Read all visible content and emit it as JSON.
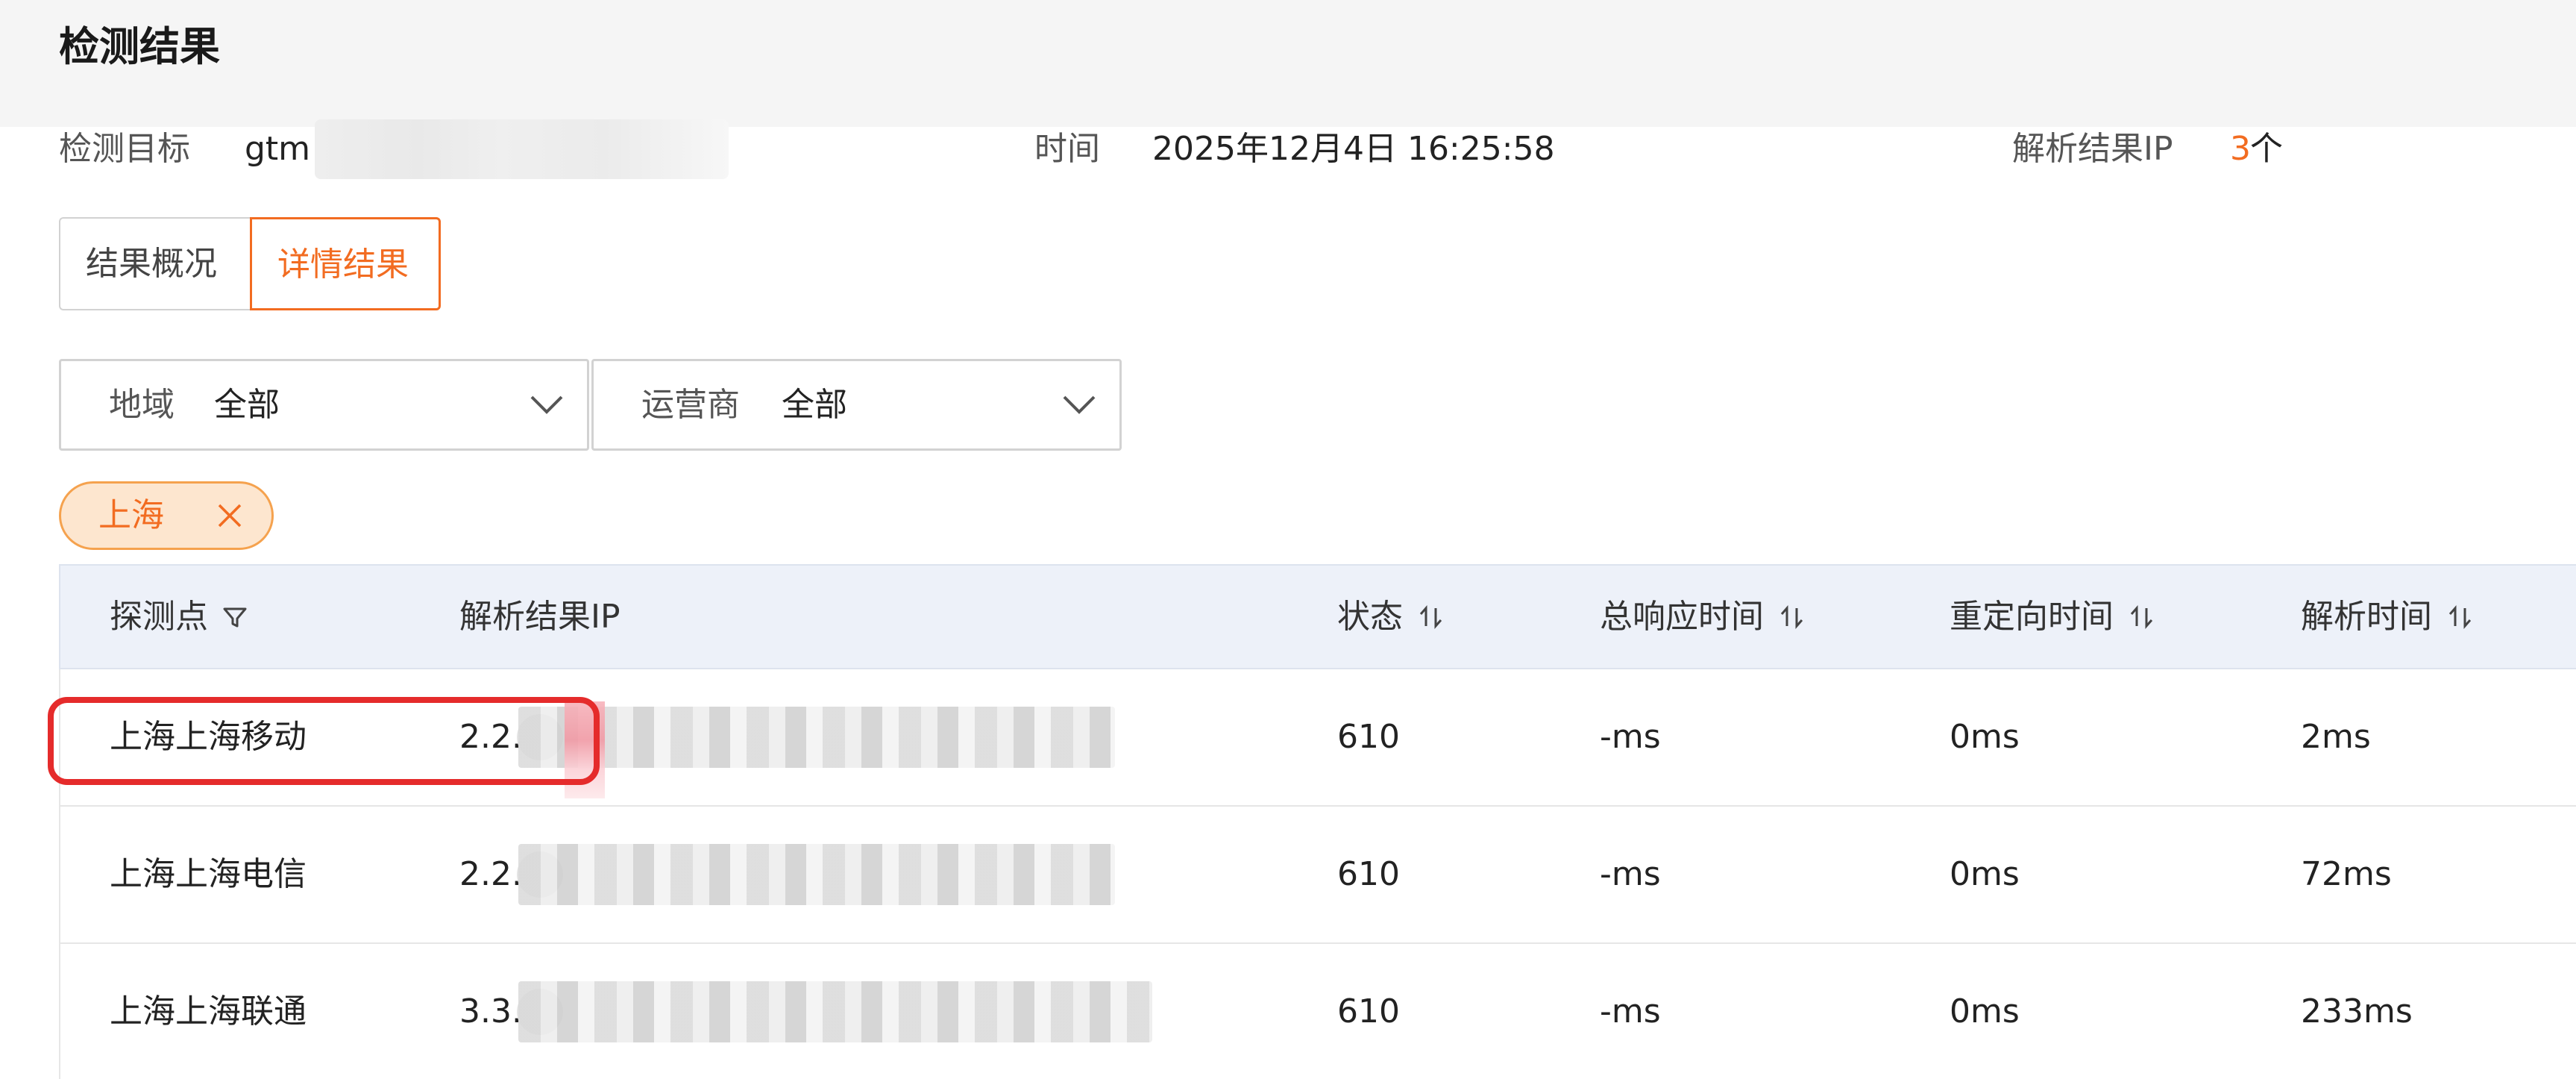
{
  "header": {
    "title": "检测结果"
  },
  "info": {
    "target_label": "检测目标",
    "target_value": "gtm",
    "time_label": "时间",
    "time_value": "2025年12月4日 16:25:58",
    "ip_label": "解析结果IP",
    "ip_count": "3",
    "ip_unit": "个"
  },
  "tabs": [
    {
      "label": "结果概况",
      "active": false
    },
    {
      "label": "详情结果",
      "active": true
    }
  ],
  "filters": {
    "region": {
      "label": "地域",
      "value": "全部"
    },
    "carrier": {
      "label": "运营商",
      "value": "全部"
    }
  },
  "active_tag": {
    "label": "上海"
  },
  "table": {
    "headers": [
      "探测点",
      "解析结果IP",
      "状态",
      "总响应时间",
      "重定向时间",
      "解析时间"
    ],
    "rows": [
      {
        "probe": "上海上海移动",
        "ip": "2.2.",
        "status": "610",
        "total": "-ms",
        "redirect": "0ms",
        "resolve": "2ms"
      },
      {
        "probe": "上海上海电信",
        "ip": "2.2.",
        "status": "610",
        "total": "-ms",
        "redirect": "0ms",
        "resolve": "72ms"
      },
      {
        "probe": "上海上海联通",
        "ip": "3.3.",
        "status": "610",
        "total": "-ms",
        "redirect": "0ms",
        "resolve": "233ms"
      }
    ]
  },
  "colors": {
    "accent": "#f26c21",
    "tag_bg": "#fde6cf",
    "header_bg": "#f5f5f5",
    "table_header_bg": "#edf1f9",
    "highlight": "#e52b2b"
  },
  "icons": {
    "sort": "sort-arrows-icon",
    "filter": "funnel-icon",
    "dropdown": "chevron-down-icon",
    "close": "close-icon"
  }
}
